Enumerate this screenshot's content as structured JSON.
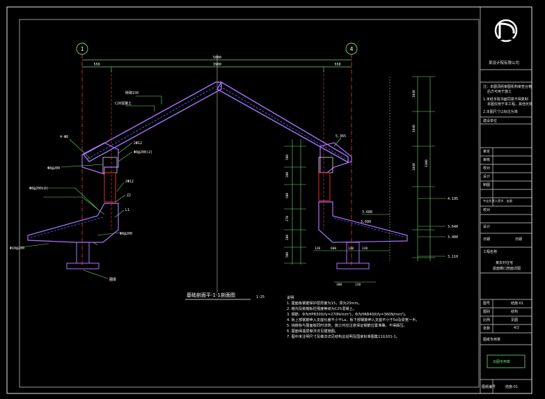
{
  "drawing": {
    "title": "基础剖面平-1-1剖面图",
    "scale": "1:25",
    "axis_left": "1",
    "axis_right": "4",
    "dim_overall": "5000",
    "dim_inner": "3900",
    "dim_left": "550",
    "dim_right": "550",
    "left_labels": [
      "砖砌150",
      "C20混凝土",
      "4-Φ8",
      "Φ8@200",
      "2Φ12",
      "Φ8@200(2)",
      "2Φ12",
      "Z2",
      "L1",
      "Φ8@200(2)",
      "Φ8@200",
      "Φ10@200",
      "圈梁"
    ],
    "right_labels": [
      "5.365",
      "3.680",
      "3.600",
      "3.110",
      "4.195",
      "3.640",
      "3.400"
    ],
    "vertical_dims": [
      "500",
      "200",
      "500",
      "270",
      "200",
      "500",
      "610",
      "420"
    ],
    "top_right_dims": [
      "1040",
      "1040",
      "1040",
      "1300"
    ],
    "bottom_dims": [
      "120",
      "600",
      "120",
      "120",
      "300",
      "120"
    ]
  },
  "notes": {
    "heading": "说明",
    "items": [
      "1. 屋面板钢筋保护层厚度为15，梁为25mm。",
      "2. 檐沟及挑檐板砼强度等级为C25混凝土。",
      "3. 钢筋：Φ为HPB300(fy=270N/mm²)，Φ为HRB400(fy=360N/mm²)。",
      "4. 板上部钢筋伸入支座长度不小于La，板下部钢筋伸入支座不小于5d及梁宽一半。",
      "5. 挑檐板与屋面板同时浇筑，施工时应注意保证钢筋位置准确，不得踩压。",
      "6. 屋面保温层做法详见建施图。",
      "7. 图中未注明尺寸及做法详见结构总说明及国家标准图集11G101-1。"
    ]
  },
  "title_block": {
    "company": "某设计院有限公司",
    "notes_lines": [
      "注：本图须经审图机构审查合格",
      "后方可用于施工",
      "",
      "1.未经本院书面同意不得复制",
      "本图仅用于本工程，其他无效",
      "",
      "2.本图尺寸以标注为准"
    ],
    "client_label": "建设单位",
    "rows": [
      "审定",
      "审核",
      "校对",
      "设计",
      "制图",
      "专业负责人签字、出图",
      "校对",
      "设计",
      "日期"
    ],
    "date_value": "日期",
    "project_label": "工程名称",
    "project_name": "某农村住宅",
    "drawing_name": "屋面檐口剖面详图",
    "meta_rows": [
      [
        "图号",
        "结施-01"
      ],
      [
        "图别",
        "结构"
      ],
      [
        "比例",
        "见图"
      ],
      [
        "张数",
        "4/2"
      ]
    ],
    "stamp_label": "图纸专用章",
    "stamp_text": "出图专用章",
    "bottom_label": "图纸编号",
    "bottom_value": "结施-01"
  }
}
